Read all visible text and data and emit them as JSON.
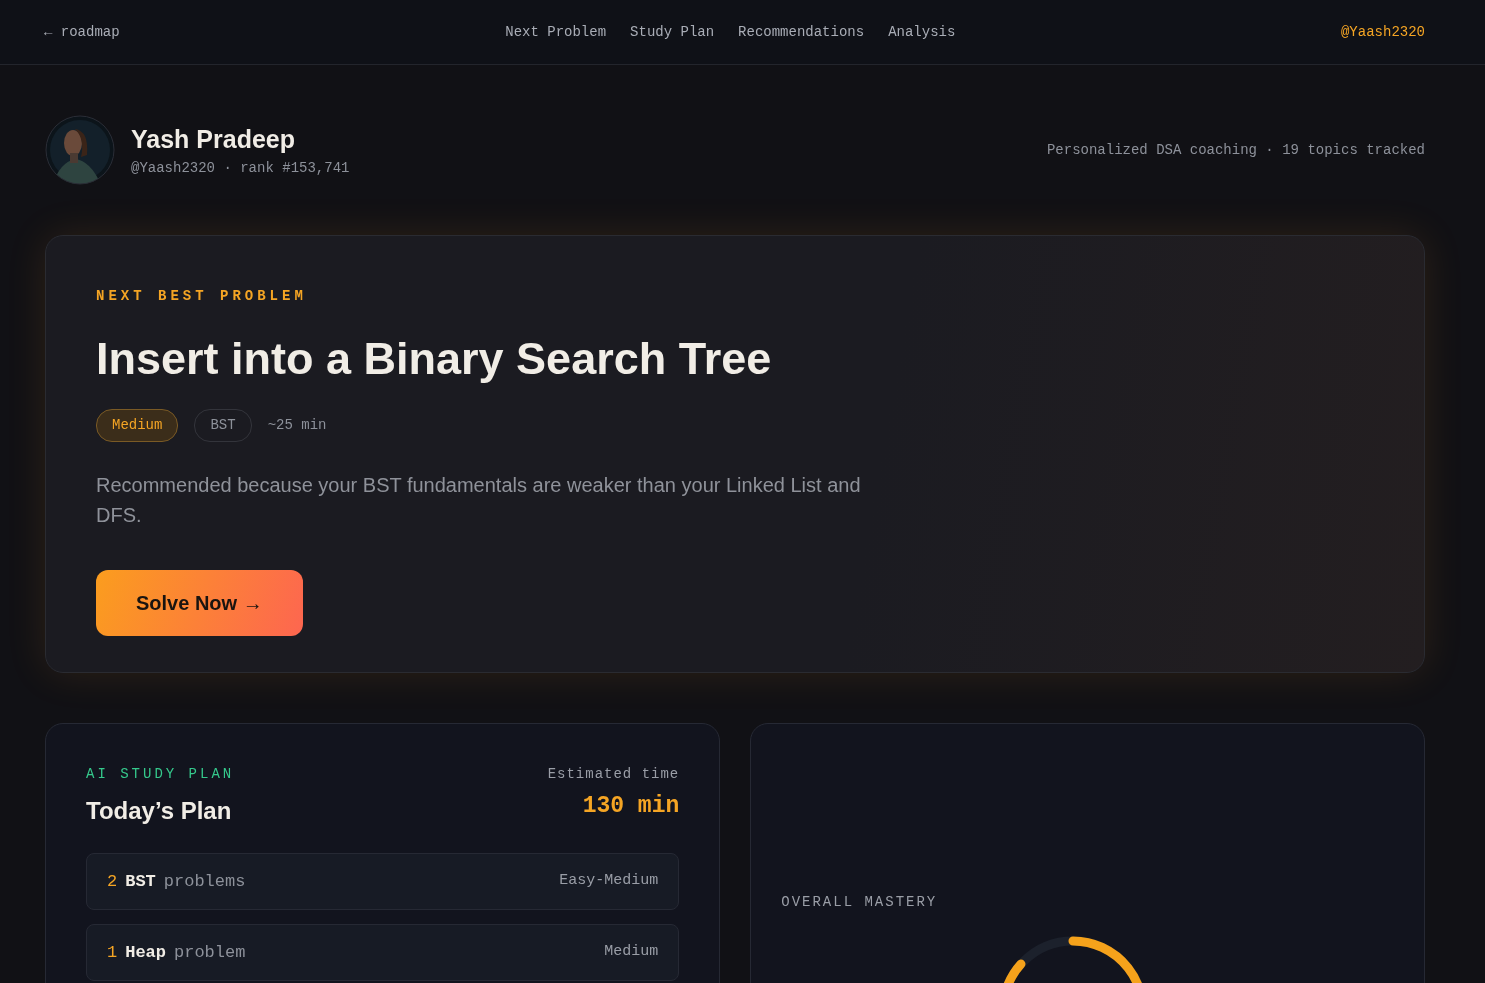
{
  "nav": {
    "back": "← roadmap",
    "links": [
      {
        "label": "Next Problem"
      },
      {
        "label": "Study Plan"
      },
      {
        "label": "Recommendations"
      },
      {
        "label": "Analysis"
      }
    ],
    "user": "@Yaash2320"
  },
  "profile": {
    "name": "Yash Pradeep",
    "meta": "@Yaash2320 · rank #153,741",
    "summary": "Personalized DSA coaching · 19 topics tracked"
  },
  "next_problem": {
    "eyebrow": "NEXT BEST PROBLEM",
    "title": "Insert into a Binary Search Tree",
    "tags": [
      {
        "kind": "difficulty",
        "label": "Medium"
      },
      {
        "kind": "topic",
        "label": "BST"
      },
      {
        "kind": "time",
        "label": "~25 min"
      }
    ],
    "reason": "Recommended because your BST fundamentals are weaker than your Linked List and DFS.",
    "button": "Solve Now →"
  },
  "study_plan": {
    "eyebrow": "AI STUDY PLAN",
    "title": "Today’s Plan",
    "estimate_label": "Estimated time",
    "estimate": "130 min",
    "items": [
      {
        "count": "2",
        "topic": "BST",
        "noun": "problems",
        "difficulty": "Easy-Medium"
      },
      {
        "count": "1",
        "topic": "Heap",
        "noun": "problem",
        "difficulty": "Medium"
      }
    ]
  },
  "mastery": {
    "label": "OVERALL MASTERY"
  }
}
